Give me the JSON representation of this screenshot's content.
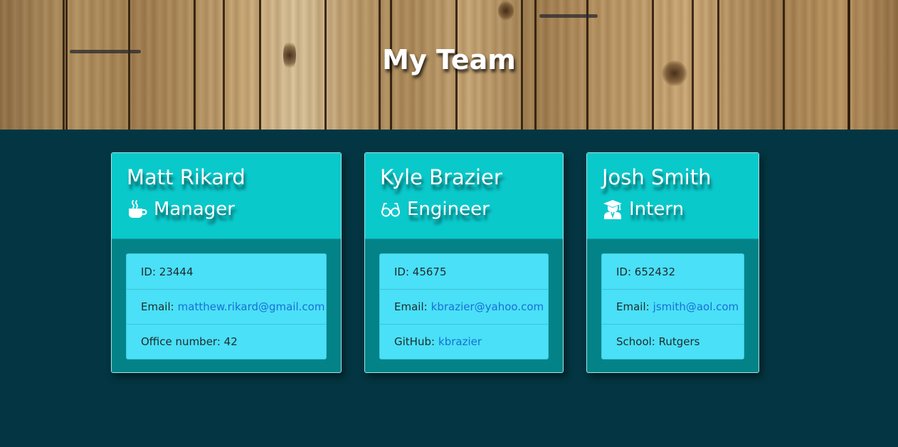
{
  "header": {
    "title": "My Team"
  },
  "colors": {
    "page_background": "#033642",
    "card_header": "#0ac9cb",
    "card_body": "#038387",
    "info_list": "#4ae0f7",
    "link": "#1a6fd6"
  },
  "cards": [
    {
      "name": "Matt Rikard",
      "role": "Manager",
      "role_icon": "coffee-cup-icon",
      "id_label": "ID: 23444",
      "email_prefix": "Email:",
      "email": "matthew.rikard@gmail.com",
      "extra_label": "Office number: 42"
    },
    {
      "name": "Kyle Brazier",
      "role": "Engineer",
      "role_icon": "glasses-icon",
      "id_label": "ID: 45675",
      "email_prefix": "Email:",
      "email": "kbrazier@yahoo.com",
      "extra_prefix": "GitHub:",
      "extra_link": "kbrazier"
    },
    {
      "name": "Josh Smith",
      "role": "Intern",
      "role_icon": "graduate-icon",
      "id_label": "ID: 652432",
      "email_prefix": "Email:",
      "email": "jsmith@aol.com",
      "extra_label": "School: Rutgers"
    }
  ]
}
